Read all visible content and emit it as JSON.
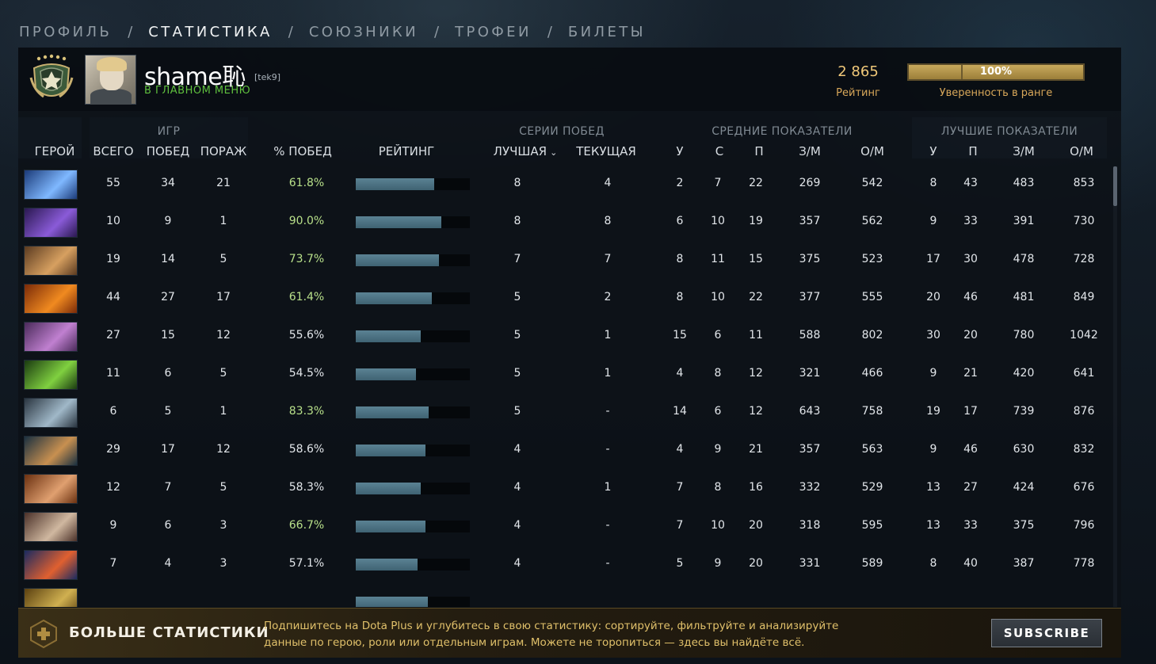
{
  "nav": {
    "tabs": [
      "ПРОФИЛЬ",
      "СТАТИСТИКА",
      "СОЮЗНИКИ",
      "ТРОФЕИ",
      "БИЛЕТЫ"
    ],
    "active_index": 1,
    "separator": "/"
  },
  "profile": {
    "name": "shame恥",
    "tag": "[tek9]",
    "status": "В ГЛАВНОМ МЕНЮ",
    "rating_value": "2 865",
    "rating_label": "Рейтинг",
    "confidence_value": "100%",
    "confidence_fraction": 1.0,
    "confidence_label": "Уверенность в ранге"
  },
  "table": {
    "group_headers": {
      "games": "ИГР",
      "streaks": "СЕРИИ ПОБЕД",
      "avg": "СРЕДНИЕ ПОКАЗАТЕЛИ",
      "best": "ЛУЧШИЕ ПОКАЗАТЕЛИ"
    },
    "columns": {
      "hero": "ГЕРОЙ",
      "total": "ВСЕГО",
      "wins": "ПОБЕД",
      "losses": "ПОРАЖ",
      "winrate": "% ПОБЕД",
      "rating": "РЕЙТИНГ",
      "best_streak": "ЛУЧШАЯ",
      "current_streak": "ТЕКУЩАЯ",
      "avg_k": "У",
      "avg_d": "С",
      "avg_a": "П",
      "avg_gpm": "З/М",
      "avg_xpm": "О/М",
      "best_k": "У",
      "best_a": "П",
      "best_gpm": "З/М",
      "best_xpm": "О/М"
    },
    "rows": [
      {
        "hero": "hero-1",
        "color": [
          "#1b3a78",
          "#7fb8ff"
        ],
        "total": "55",
        "wins": "34",
        "losses": "21",
        "winrate": "61.8%",
        "rating": 0.69,
        "best_streak": "8",
        "current_streak": "4",
        "avg_k": "2",
        "avg_d": "7",
        "avg_a": "22",
        "avg_gpm": "269",
        "avg_xpm": "542",
        "best_k": "8",
        "best_a": "43",
        "best_gpm": "483",
        "best_xpm": "853",
        "high": true
      },
      {
        "hero": "hero-2",
        "color": [
          "#2a1850",
          "#8a5bd8"
        ],
        "total": "10",
        "wins": "9",
        "losses": "1",
        "winrate": "90.0%",
        "rating": 0.75,
        "best_streak": "8",
        "current_streak": "8",
        "avg_k": "6",
        "avg_d": "10",
        "avg_a": "19",
        "avg_gpm": "357",
        "avg_xpm": "562",
        "best_k": "9",
        "best_a": "33",
        "best_gpm": "391",
        "best_xpm": "730",
        "high": true
      },
      {
        "hero": "hero-3",
        "color": [
          "#5a3a20",
          "#d7a060"
        ],
        "total": "19",
        "wins": "14",
        "losses": "5",
        "winrate": "73.7%",
        "rating": 0.73,
        "best_streak": "7",
        "current_streak": "7",
        "avg_k": "8",
        "avg_d": "11",
        "avg_a": "15",
        "avg_gpm": "375",
        "avg_xpm": "523",
        "best_k": "17",
        "best_a": "30",
        "best_gpm": "478",
        "best_xpm": "728",
        "high": true
      },
      {
        "hero": "hero-4",
        "color": [
          "#7a2a08",
          "#f08a20"
        ],
        "total": "44",
        "wins": "27",
        "losses": "17",
        "winrate": "61.4%",
        "rating": 0.67,
        "best_streak": "5",
        "current_streak": "2",
        "avg_k": "8",
        "avg_d": "10",
        "avg_a": "22",
        "avg_gpm": "377",
        "avg_xpm": "555",
        "best_k": "20",
        "best_a": "46",
        "best_gpm": "481",
        "best_xpm": "849",
        "high": true
      },
      {
        "hero": "hero-5",
        "color": [
          "#4a2a5a",
          "#c080d0"
        ],
        "total": "27",
        "wins": "15",
        "losses": "12",
        "winrate": "55.6%",
        "rating": 0.57,
        "best_streak": "5",
        "current_streak": "1",
        "avg_k": "15",
        "avg_d": "6",
        "avg_a": "11",
        "avg_gpm": "588",
        "avg_xpm": "802",
        "best_k": "30",
        "best_a": "20",
        "best_gpm": "780",
        "best_xpm": "1042",
        "high": false
      },
      {
        "hero": "hero-6",
        "color": [
          "#1a3a10",
          "#80d040"
        ],
        "total": "11",
        "wins": "6",
        "losses": "5",
        "winrate": "54.5%",
        "rating": 0.53,
        "best_streak": "5",
        "current_streak": "1",
        "avg_k": "4",
        "avg_d": "8",
        "avg_a": "12",
        "avg_gpm": "321",
        "avg_xpm": "466",
        "best_k": "9",
        "best_a": "21",
        "best_gpm": "420",
        "best_xpm": "641",
        "high": false
      },
      {
        "hero": "hero-7",
        "color": [
          "#2a3540",
          "#a0b8c8"
        ],
        "total": "6",
        "wins": "5",
        "losses": "1",
        "winrate": "83.3%",
        "rating": 0.64,
        "best_streak": "5",
        "current_streak": "-",
        "avg_k": "14",
        "avg_d": "6",
        "avg_a": "12",
        "avg_gpm": "643",
        "avg_xpm": "758",
        "best_k": "19",
        "best_a": "17",
        "best_gpm": "739",
        "best_xpm": "876",
        "high": true
      },
      {
        "hero": "hero-8",
        "color": [
          "#1a3040",
          "#c89050"
        ],
        "total": "29",
        "wins": "17",
        "losses": "12",
        "winrate": "58.6%",
        "rating": 0.61,
        "best_streak": "4",
        "current_streak": "-",
        "avg_k": "4",
        "avg_d": "9",
        "avg_a": "21",
        "avg_gpm": "357",
        "avg_xpm": "563",
        "best_k": "9",
        "best_a": "46",
        "best_gpm": "630",
        "best_xpm": "832",
        "high": false
      },
      {
        "hero": "hero-9",
        "color": [
          "#6a3010",
          "#e0a070"
        ],
        "total": "12",
        "wins": "7",
        "losses": "5",
        "winrate": "58.3%",
        "rating": 0.57,
        "best_streak": "4",
        "current_streak": "1",
        "avg_k": "7",
        "avg_d": "8",
        "avg_a": "16",
        "avg_gpm": "332",
        "avg_xpm": "529",
        "best_k": "13",
        "best_a": "27",
        "best_gpm": "424",
        "best_xpm": "676",
        "high": false
      },
      {
        "hero": "hero-10",
        "color": [
          "#4a3028",
          "#d0b8a0"
        ],
        "total": "9",
        "wins": "6",
        "losses": "3",
        "winrate": "66.7%",
        "rating": 0.61,
        "best_streak": "4",
        "current_streak": "-",
        "avg_k": "7",
        "avg_d": "10",
        "avg_a": "20",
        "avg_gpm": "318",
        "avg_xpm": "595",
        "best_k": "13",
        "best_a": "33",
        "best_gpm": "375",
        "best_xpm": "796",
        "high": true
      },
      {
        "hero": "hero-11",
        "color": [
          "#1a2a60",
          "#e06030"
        ],
        "total": "7",
        "wins": "4",
        "losses": "3",
        "winrate": "57.1%",
        "rating": 0.54,
        "best_streak": "4",
        "current_streak": "-",
        "avg_k": "5",
        "avg_d": "9",
        "avg_a": "20",
        "avg_gpm": "331",
        "avg_xpm": "589",
        "best_k": "8",
        "best_a": "40",
        "best_gpm": "387",
        "best_xpm": "778",
        "high": false
      },
      {
        "hero": "hero-12",
        "color": [
          "#5a4010",
          "#d0b050"
        ],
        "total": "",
        "wins": "",
        "losses": "",
        "winrate": "",
        "rating": 0.63,
        "best_streak": "",
        "current_streak": "",
        "avg_k": "",
        "avg_d": "",
        "avg_a": "",
        "avg_gpm": "",
        "avg_xpm": "",
        "best_k": "",
        "best_a": "",
        "best_gpm": "",
        "best_xpm": "",
        "high": false
      }
    ]
  },
  "footer": {
    "title": "БОЛЬШЕ СТАТИСТИКИ",
    "description": "Подпишитесь на Dota Plus и углубитесь в свою статистику: сортируйте, фильтруйте и анализируйте данные по герою, роли или отдельным играм. Можете не торопиться — здесь вы найдёте всё.",
    "subscribe_label": "SUBSCRIBE"
  },
  "colors": {
    "gold": "#d9a85a",
    "green_status": "#5fbf3e",
    "winrate_high": "#b8e08a",
    "rating_bar": "#4f7383"
  }
}
